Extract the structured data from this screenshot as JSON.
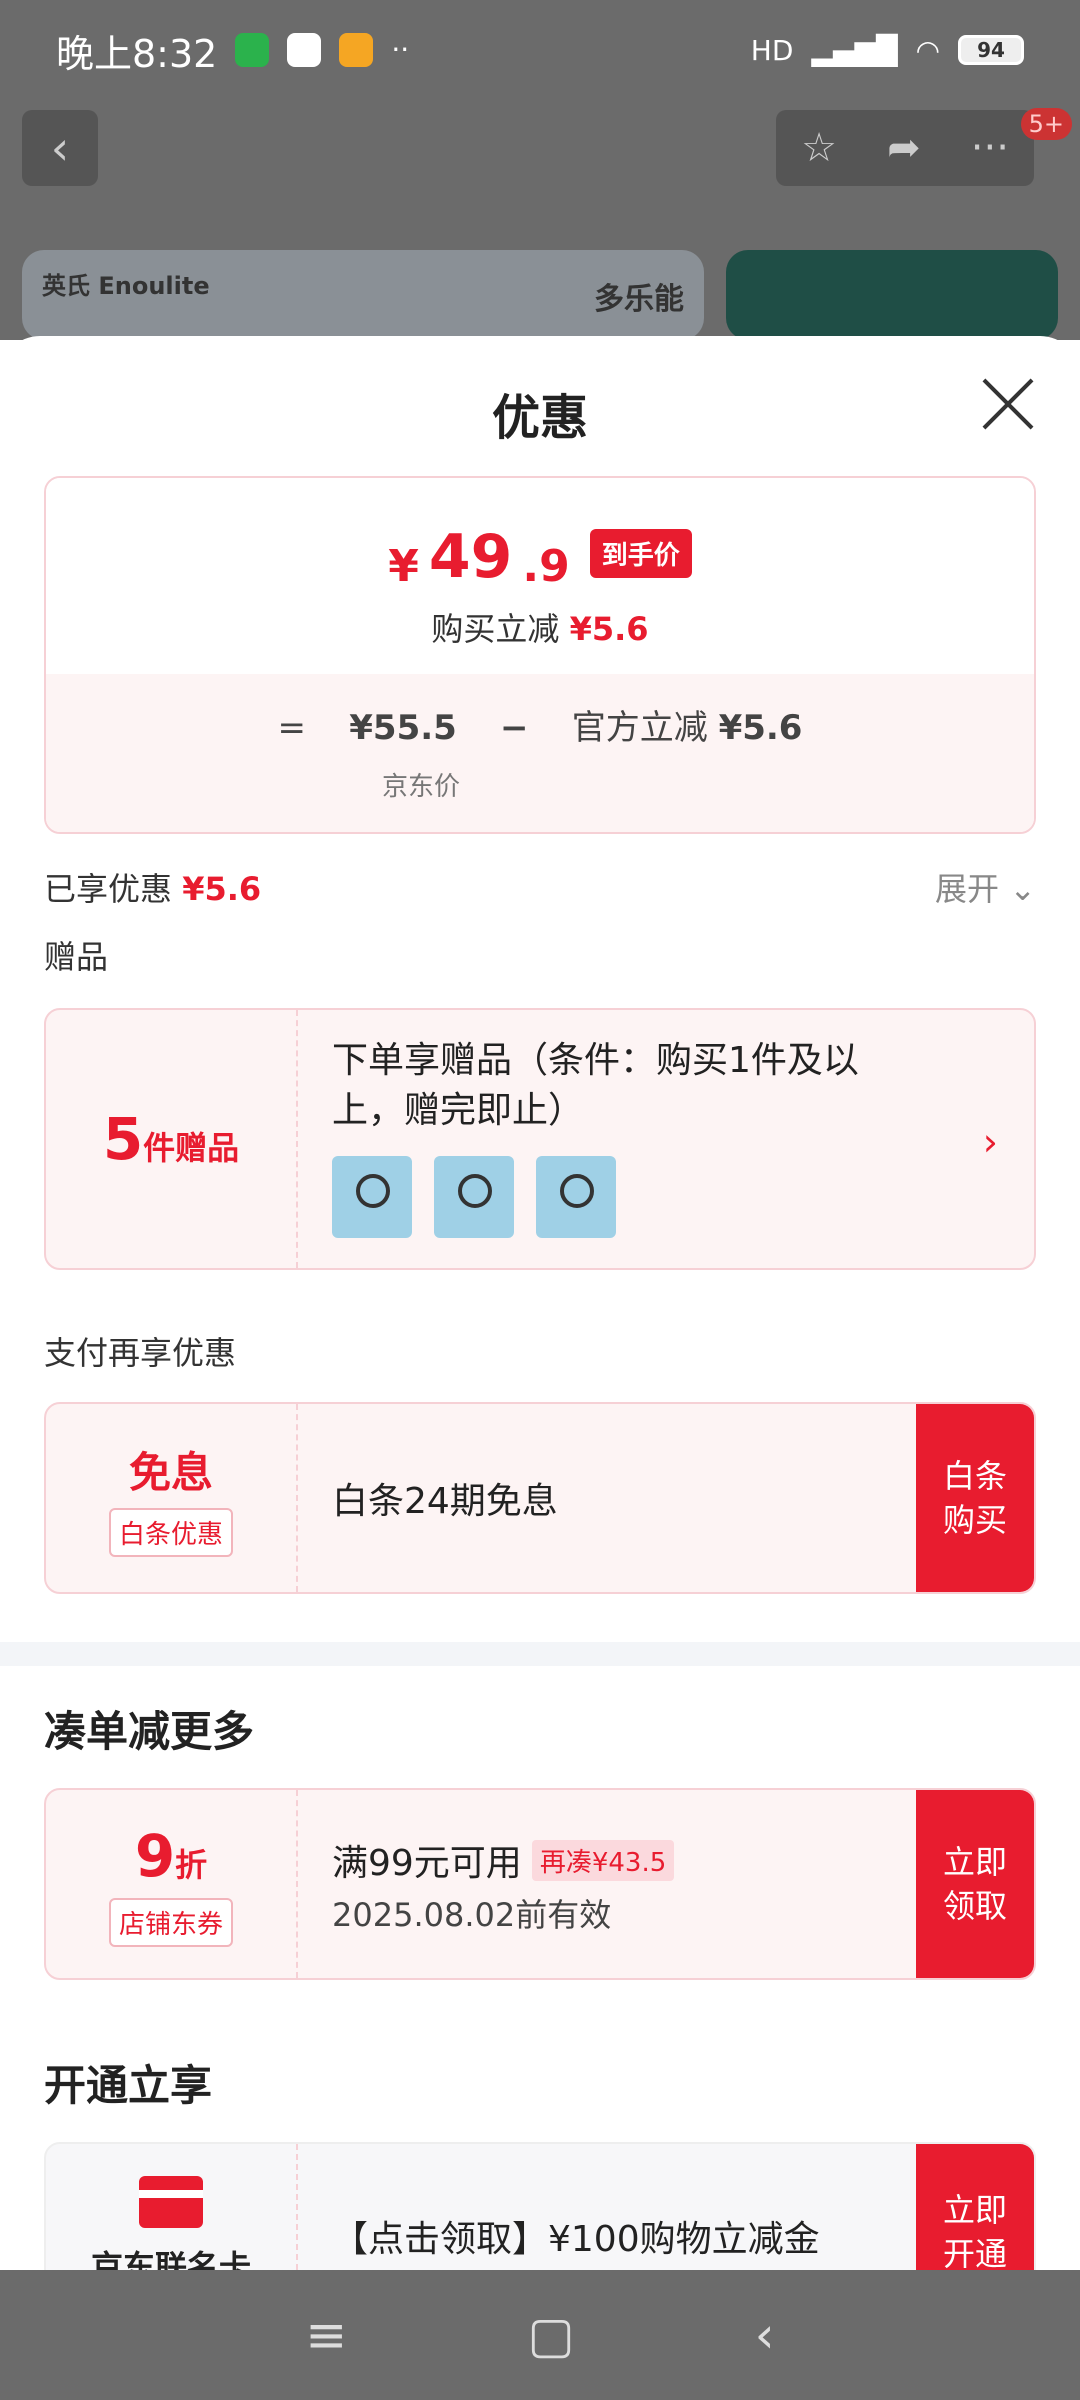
{
  "status": {
    "time": "晚上8:32",
    "battery": "94",
    "signal": "HD"
  },
  "nav": {
    "back_icon": "‹",
    "star_icon": "☆",
    "share_icon": "➦",
    "more_icon": "···",
    "badge": "5+"
  },
  "banner": {
    "brand": "英氏 Enoulite",
    "slogan": "多乐能"
  },
  "sheet": {
    "title": "优惠",
    "final_price": {
      "yen": "¥",
      "integer": "49",
      "decimal": ".9",
      "tag": "到手价"
    },
    "reduce": {
      "label": "购买立减",
      "value": "¥5.6"
    },
    "formula": {
      "equals": "=",
      "jd_price": "¥55.5",
      "minus": "−",
      "official_label": "官方立减",
      "official_value": "¥5.6",
      "jd_label": "京东价"
    },
    "enjoyed": {
      "label": "已享优惠",
      "value": "¥5.6",
      "expand": "展开"
    },
    "gift": {
      "section_title": "赠品",
      "count": "5",
      "count_unit": "件赠品",
      "desc": "下单享赠品（条件：购买1件及以上，赠完即止）",
      "chevron": "›"
    },
    "pay": {
      "section_title": "支付再享优惠",
      "main": "免息",
      "tag": "白条优惠",
      "desc": "白条24期免息",
      "action": "白条购买"
    },
    "coudan": {
      "title": "凑单减更多",
      "discount": "9",
      "discount_unit": "折",
      "tag": "店铺东券",
      "cond": "满99元可用",
      "extra": "再凑¥43.5",
      "valid": "2025.08.02前有效",
      "action": "立即领取"
    },
    "kaitong": {
      "title": "开通立享",
      "member_name": "京东联名卡",
      "desc": "【点击领取】¥100购物立减金",
      "action": "立即开通"
    }
  }
}
